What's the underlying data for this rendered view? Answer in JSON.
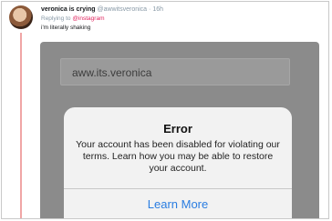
{
  "tweet": {
    "author_name": "veronica is crying",
    "author_handle": "@awwitsveronica",
    "time": "16h",
    "reply_prefix": "Replying to",
    "reply_to": "@instagram",
    "text": "i'm literally shaking"
  },
  "screenshot": {
    "username_value": "aww.its.veronica",
    "alert": {
      "title": "Error",
      "message": "Your account has been disabled for violating our terms. Learn how you may be able to restore your account.",
      "button_label": "Learn More"
    }
  },
  "colors": {
    "thread_line": "#f0a6a6",
    "mention": "#e0245e",
    "alert_button": "#2a7de1"
  }
}
